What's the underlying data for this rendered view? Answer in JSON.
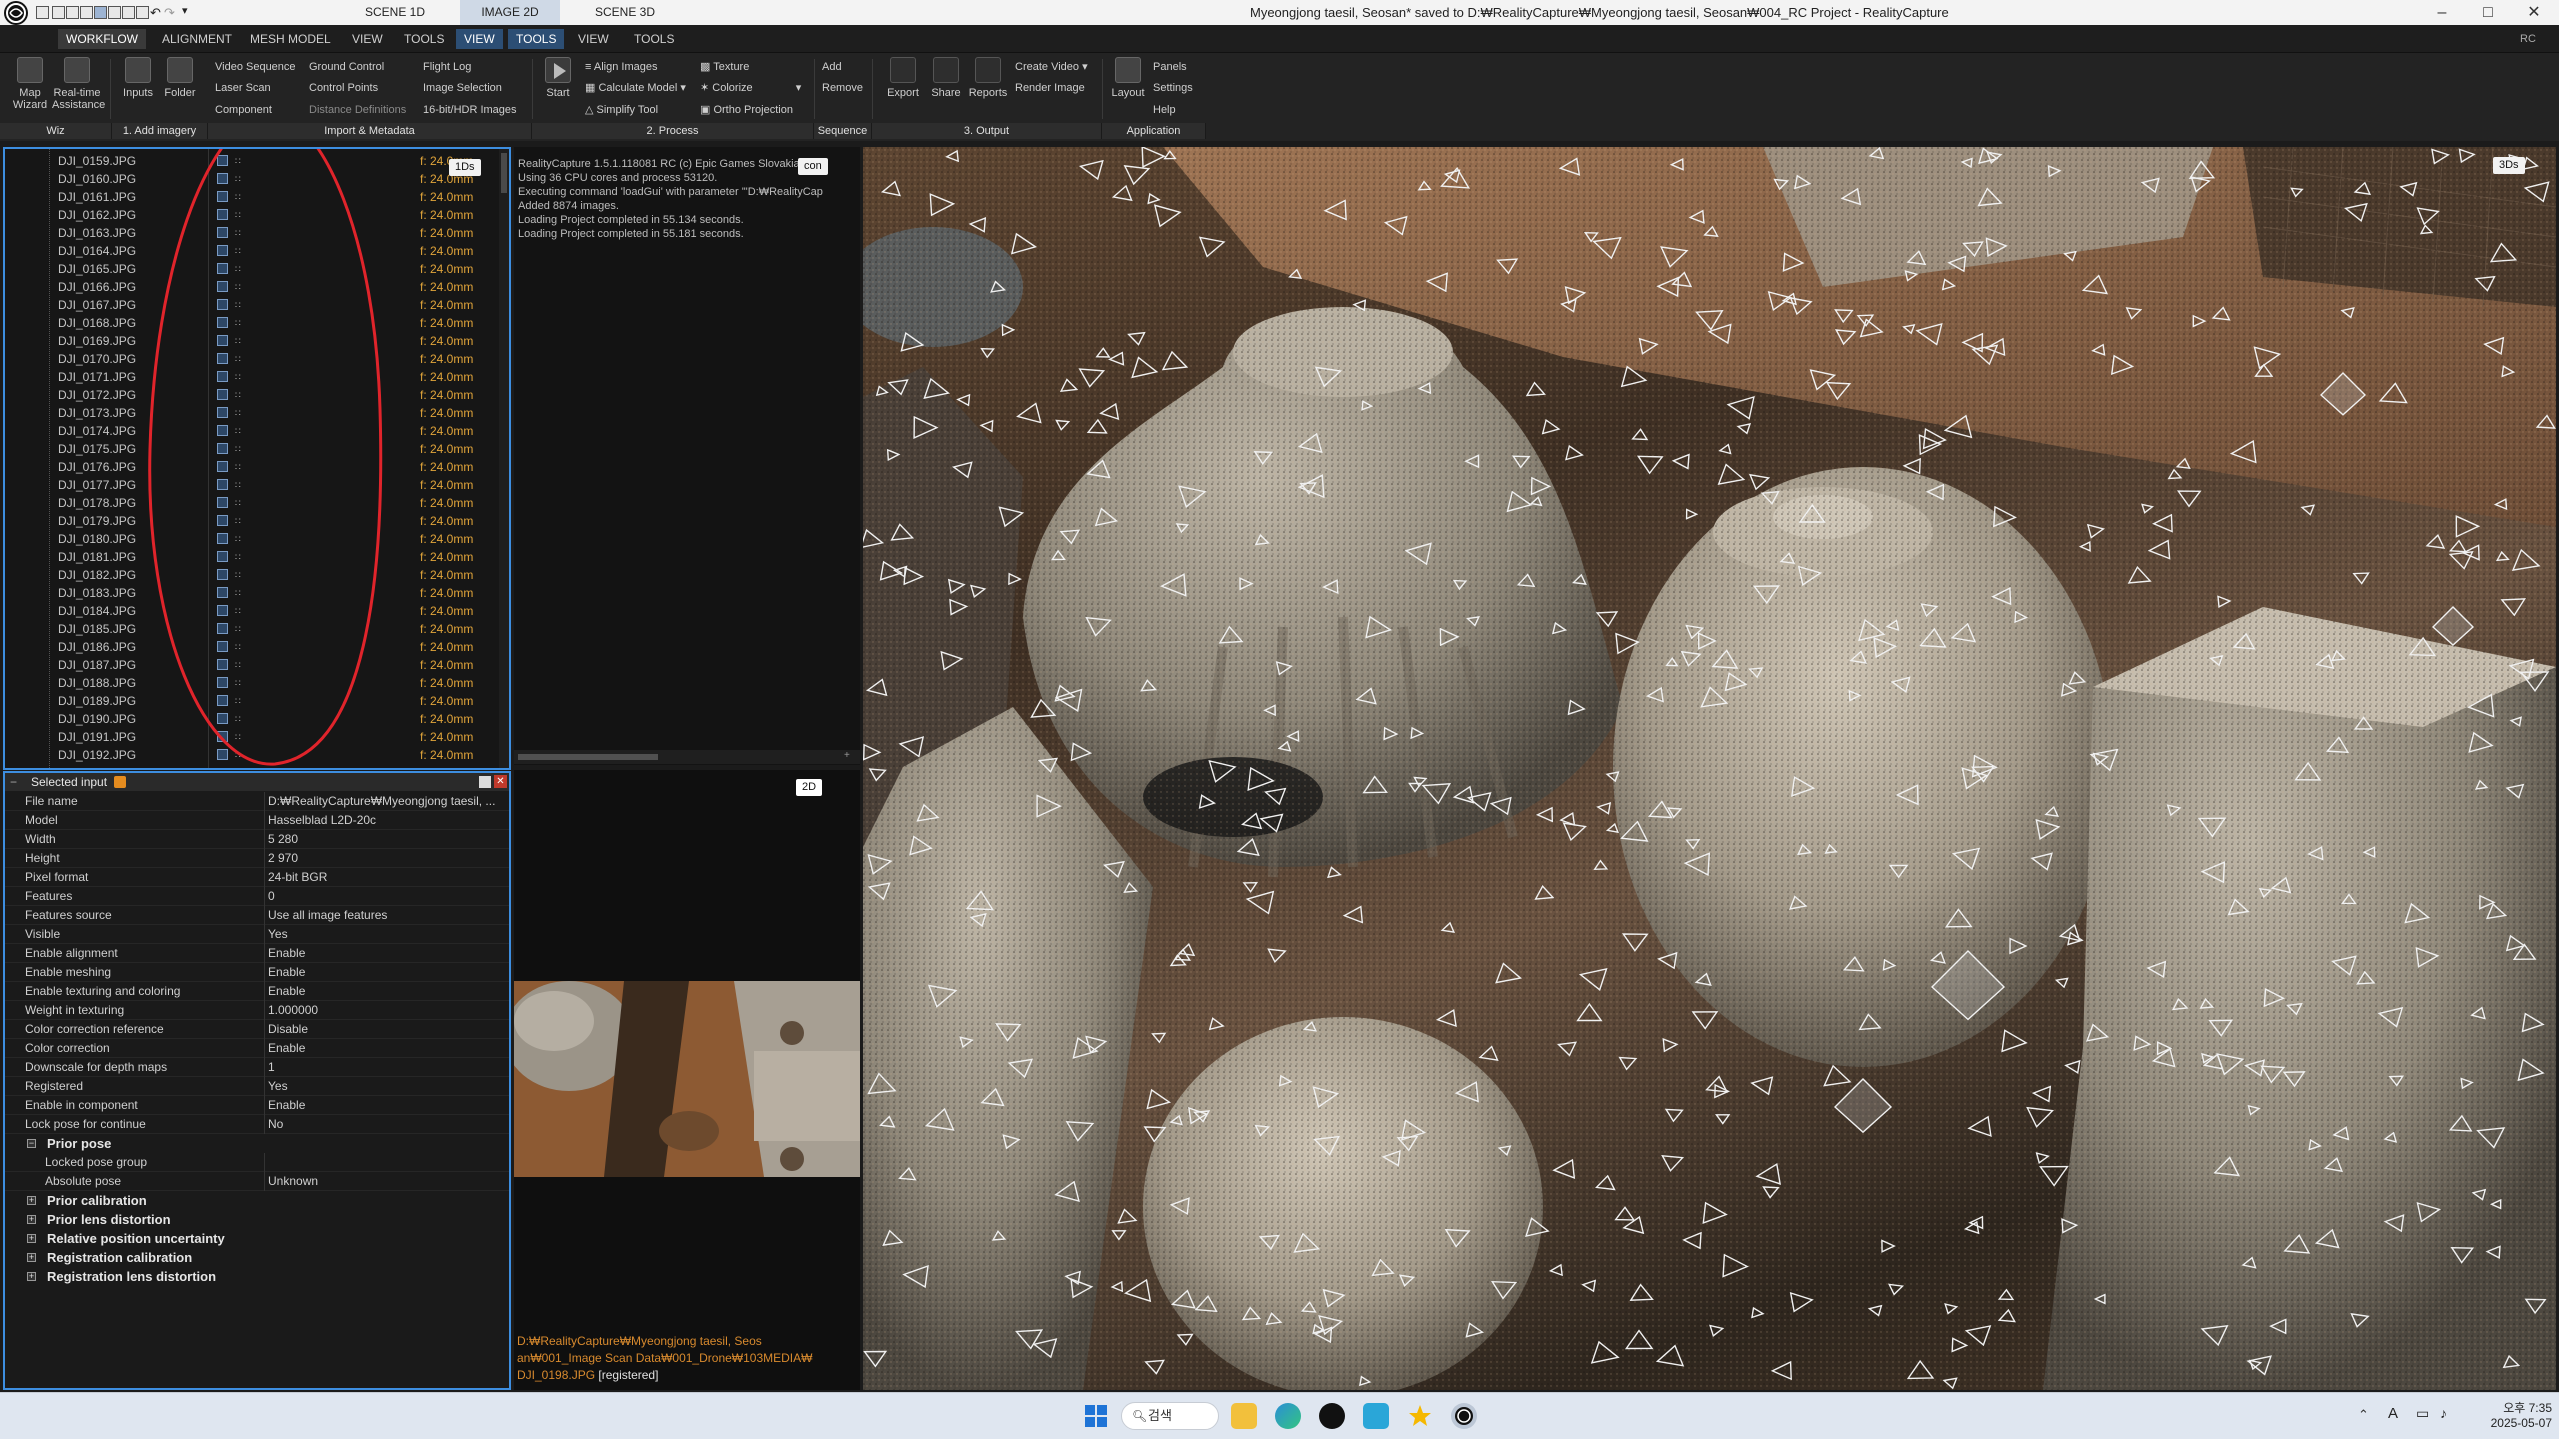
{
  "titlebar": {
    "scene_tabs": [
      "SCENE 1D",
      "IMAGE 2D",
      "SCENE 3D"
    ],
    "title": "Myeongjong taesil, Seosan* saved to D:₩RealityCapture₩Myeongjong taesil, Seosan₩004_RC Project - RealityCapture",
    "minimize": "–",
    "maximize": "□",
    "close": "✕"
  },
  "menubar": {
    "items": [
      "WORKFLOW",
      "ALIGNMENT",
      "MESH MODEL",
      "VIEW",
      "TOOLS",
      "VIEW",
      "TOOLS",
      "VIEW",
      "TOOLS"
    ],
    "right": "RC"
  },
  "ribbon": {
    "map_wizard": "Map\nWizard",
    "realtime": "Real-time\nAssistance",
    "inputs": "Inputs",
    "folder": "Folder",
    "video_sequence": "Video Sequence",
    "laser_scan": "Laser Scan",
    "component": "Component",
    "ground_control": "Ground Control",
    "control_points": "Control Points",
    "distance_definitions": "Distance Definitions",
    "flight_log": "Flight Log",
    "image_selection": "Image Selection",
    "hdr_images": "16-bit/HDR Images",
    "start": "Start",
    "align_images": "Align Images",
    "calculate_model": "Calculate Model",
    "simplify_tool": "Simplify Tool",
    "texture": "Texture",
    "colorize": "Colorize",
    "ortho_projection": "Ortho Projection",
    "add": "Add",
    "remove": "Remove",
    "export": "Export",
    "share": "Share",
    "reports": "Reports",
    "create_video": "Create Video",
    "render_image": "Render Image",
    "layout": "Layout",
    "panels": "Panels",
    "settings": "Settings",
    "help": "Help",
    "sections": [
      "Wiz",
      "1. Add imagery",
      "Import & Metadata",
      "2. Process",
      "Sequence",
      "3. Output",
      "Application"
    ]
  },
  "panel_1d": {
    "badge": "1Ds",
    "rows": [
      {
        "name": "DJI_0159.JPG",
        "focal": "f: 24.0mm"
      },
      {
        "name": "DJI_0160.JPG",
        "focal": "f: 24.0mm"
      },
      {
        "name": "DJI_0161.JPG",
        "focal": "f: 24.0mm"
      },
      {
        "name": "DJI_0162.JPG",
        "focal": "f: 24.0mm"
      },
      {
        "name": "DJI_0163.JPG",
        "focal": "f: 24.0mm"
      },
      {
        "name": "DJI_0164.JPG",
        "focal": "f: 24.0mm"
      },
      {
        "name": "DJI_0165.JPG",
        "focal": "f: 24.0mm"
      },
      {
        "name": "DJI_0166.JPG",
        "focal": "f: 24.0mm"
      },
      {
        "name": "DJI_0167.JPG",
        "focal": "f: 24.0mm"
      },
      {
        "name": "DJI_0168.JPG",
        "focal": "f: 24.0mm"
      },
      {
        "name": "DJI_0169.JPG",
        "focal": "f: 24.0mm"
      },
      {
        "name": "DJI_0170.JPG",
        "focal": "f: 24.0mm"
      },
      {
        "name": "DJI_0171.JPG",
        "focal": "f: 24.0mm"
      },
      {
        "name": "DJI_0172.JPG",
        "focal": "f: 24.0mm"
      },
      {
        "name": "DJI_0173.JPG",
        "focal": "f: 24.0mm"
      },
      {
        "name": "DJI_0174.JPG",
        "focal": "f: 24.0mm"
      },
      {
        "name": "DJI_0175.JPG",
        "focal": "f: 24.0mm"
      },
      {
        "name": "DJI_0176.JPG",
        "focal": "f: 24.0mm"
      },
      {
        "name": "DJI_0177.JPG",
        "focal": "f: 24.0mm"
      },
      {
        "name": "DJI_0178.JPG",
        "focal": "f: 24.0mm"
      },
      {
        "name": "DJI_0179.JPG",
        "focal": "f: 24.0mm"
      },
      {
        "name": "DJI_0180.JPG",
        "focal": "f: 24.0mm"
      },
      {
        "name": "DJI_0181.JPG",
        "focal": "f: 24.0mm"
      },
      {
        "name": "DJI_0182.JPG",
        "focal": "f: 24.0mm"
      },
      {
        "name": "DJI_0183.JPG",
        "focal": "f: 24.0mm"
      },
      {
        "name": "DJI_0184.JPG",
        "focal": "f: 24.0mm"
      },
      {
        "name": "DJI_0185.JPG",
        "focal": "f: 24.0mm"
      },
      {
        "name": "DJI_0186.JPG",
        "focal": "f: 24.0mm"
      },
      {
        "name": "DJI_0187.JPG",
        "focal": "f: 24.0mm"
      },
      {
        "name": "DJI_0188.JPG",
        "focal": "f: 24.0mm"
      },
      {
        "name": "DJI_0189.JPG",
        "focal": "f: 24.0mm"
      },
      {
        "name": "DJI_0190.JPG",
        "focal": "f: 24.0mm"
      },
      {
        "name": "DJI_0191.JPG",
        "focal": "f: 24.0mm"
      },
      {
        "name": "DJI_0192.JPG",
        "focal": "f: 24.0mm"
      }
    ],
    "annotation_color": "#e0242b"
  },
  "console": {
    "badge": "con",
    "lines": [
      "RealityCapture 1.5.1.118081 RC (c) Epic Games Slovakia s.r.o.",
      "Using 36 CPU cores and process 53120.",
      "Executing command 'loadGui' with parameter '\"D:₩RealityCap",
      "Added 8874 images.",
      "Loading Project completed in 55.134 seconds.",
      "Loading Project completed in 55.181 seconds."
    ]
  },
  "panel_2d": {
    "badge": "2D",
    "path_lines": [
      "D:₩RealityCapture₩Myeongjong taesil, Seos",
      "an₩001_Image Scan Data₩001_Drone₩103MEDIA₩"
    ],
    "filename": "DJI_0198.JPG",
    "status": "[registered]"
  },
  "inspector": {
    "title": "Selected input",
    "properties": [
      {
        "key": "File name",
        "value": "D:₩RealityCapture₩Myeongjong taesil, ..."
      },
      {
        "key": "Model",
        "value": "Hasselblad L2D-20c"
      },
      {
        "key": "Width",
        "value": "5 280"
      },
      {
        "key": "Height",
        "value": "2 970"
      },
      {
        "key": "Pixel format",
        "value": "24-bit BGR"
      },
      {
        "key": "Features",
        "value": "0"
      },
      {
        "key": "Features source",
        "value": "Use all image features"
      },
      {
        "key": "Visible",
        "value": "Yes"
      },
      {
        "key": "Enable alignment",
        "value": "Enable"
      },
      {
        "key": "Enable meshing",
        "value": "Enable"
      },
      {
        "key": "Enable texturing and coloring",
        "value": "Enable"
      },
      {
        "key": "Weight in texturing",
        "value": "1.000000"
      },
      {
        "key": "Color correction reference",
        "value": "Disable"
      },
      {
        "key": "Color correction",
        "value": "Enable"
      },
      {
        "key": "Downscale for depth maps",
        "value": "1"
      },
      {
        "key": "Registered",
        "value": "Yes"
      },
      {
        "key": "Enable in component",
        "value": "Enable"
      },
      {
        "key": "Lock pose for continue",
        "value": "No"
      }
    ],
    "prior_pose": {
      "label": "Prior pose",
      "rows": [
        {
          "key": "Locked pose group",
          "value": ""
        },
        {
          "key": "Absolute pose",
          "value": "Unknown"
        }
      ]
    },
    "groups": [
      "Prior calibration",
      "Prior lens distortion",
      "Relative position uncertainty",
      "Registration calibration",
      "Registration lens distortion"
    ]
  },
  "viewport_3d": {
    "badge": "3Ds"
  },
  "taskbar": {
    "search": "검색",
    "ime": "A",
    "time": "오후 7:35",
    "date": "2025-05-07"
  },
  "colors": {
    "accent_blue": "#3d8ee0",
    "focal_orange": "#e0a43a",
    "path_orange": "#d88a2e"
  }
}
